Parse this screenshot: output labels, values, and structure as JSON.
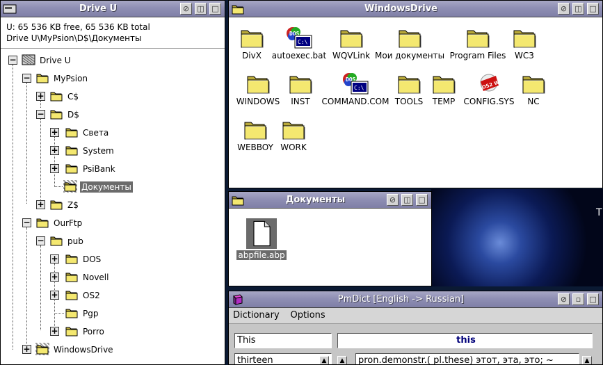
{
  "drive_window": {
    "title": "Drive U",
    "info_line1": "U:  65 536 KB free,  65 536 KB total",
    "info_line2": "Drive U\\MyPsion\\D$\\Документы",
    "tree": [
      {
        "label": "Drive U"
      },
      {
        "label": "MyPsion"
      },
      {
        "label": "C$"
      },
      {
        "label": "D$"
      },
      {
        "label": "Света"
      },
      {
        "label": "System"
      },
      {
        "label": "PsiBank"
      },
      {
        "label": "Документы"
      },
      {
        "label": "Z$"
      },
      {
        "label": "OurFtp"
      },
      {
        "label": "pub"
      },
      {
        "label": "DOS"
      },
      {
        "label": "Novell"
      },
      {
        "label": "OS2"
      },
      {
        "label": "Pgp"
      },
      {
        "label": "Porro"
      },
      {
        "label": "WindowsDrive"
      }
    ]
  },
  "windows_drive": {
    "title": "WindowsDrive",
    "items": [
      {
        "label": "DivX",
        "icon": "folder-icon"
      },
      {
        "label": "autoexec.bat",
        "icon": "dos-program-icon"
      },
      {
        "label": "WQVLink",
        "icon": "folder-icon"
      },
      {
        "label": "Мои документы",
        "icon": "folder-icon"
      },
      {
        "label": "Program Files",
        "icon": "folder-icon"
      },
      {
        "label": "WC3",
        "icon": "folder-icon"
      },
      {
        "label": "WINDOWS",
        "icon": "folder-icon"
      },
      {
        "label": "INST",
        "icon": "folder-icon"
      },
      {
        "label": "COMMAND.COM",
        "icon": "dos-program-icon"
      },
      {
        "label": "TOOLS",
        "icon": "folder-icon"
      },
      {
        "label": "TEMP",
        "icon": "folder-icon"
      },
      {
        "label": "CONFIG.SYS",
        "icon": "os2-warp-icon"
      },
      {
        "label": "NC",
        "icon": "folder-icon"
      },
      {
        "label": "WEBBOY",
        "icon": "folder-icon"
      },
      {
        "label": "WORK",
        "icon": "folder-icon"
      }
    ]
  },
  "documents_window": {
    "title": "Документы",
    "items": [
      {
        "label": "abpfile.abp",
        "icon": "file-icon"
      }
    ]
  },
  "pmdict": {
    "title": "PmDict  [English -> Russian]",
    "menu": [
      "Dictionary",
      "Options"
    ],
    "search_value": "This",
    "headword": "this",
    "word_list": [
      "thirteen"
    ],
    "definition": "pron.demonstr.( pl.these) этот, эта, это; ~"
  },
  "desktop": {
    "partial_text": "T"
  },
  "colors": {
    "title_active": "#8f8fb4",
    "selection": "#6b6b6b",
    "folder_yellow": "#f2e46a",
    "headword_blue": "#00007a"
  }
}
